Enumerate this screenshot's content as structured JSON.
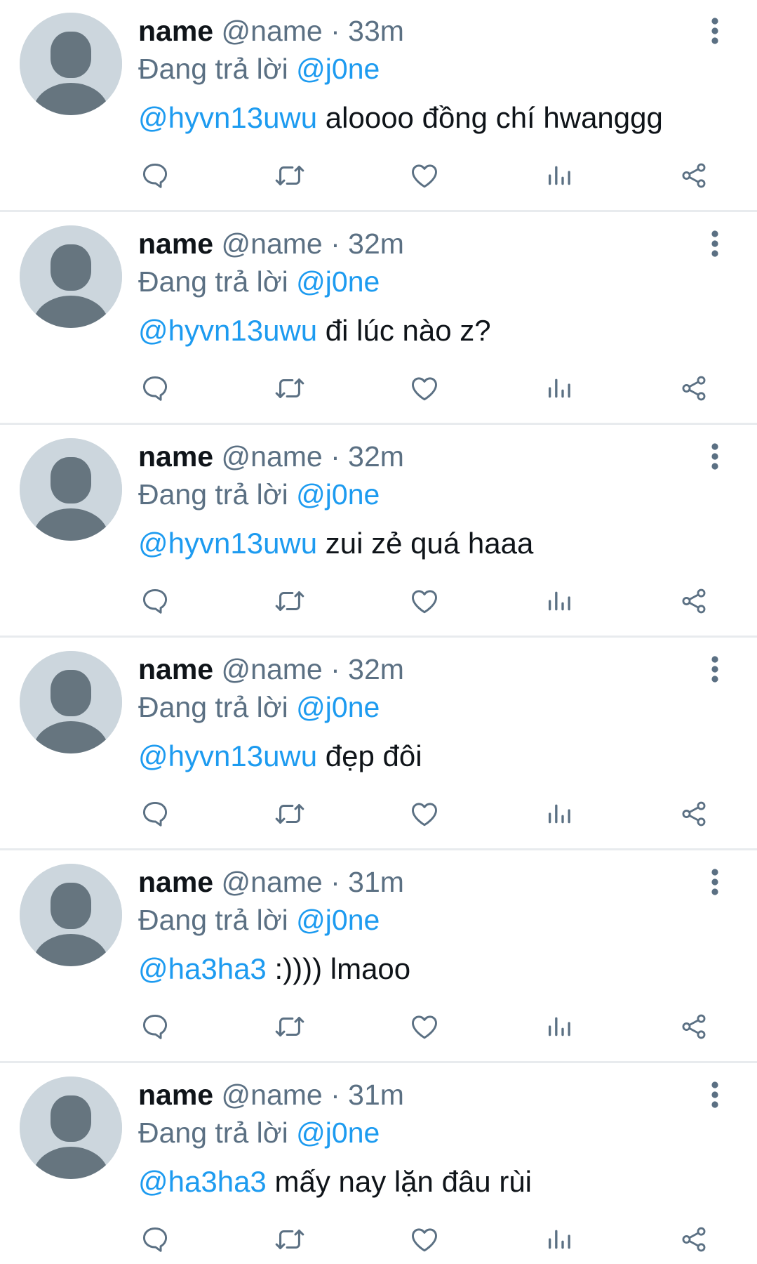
{
  "colors": {
    "primary_text": "#0f1419",
    "secondary_text": "#5b7083",
    "link": "#1d9bf0",
    "avatar_bg": "#ccd6dd",
    "avatar_fg": "#66757f",
    "divider": "#e8ebee"
  },
  "icons": {
    "reply": "reply-icon",
    "retweet": "retweet-icon",
    "like": "heart-icon",
    "views": "views-icon",
    "share": "share-icon",
    "more": "more-vertical-icon",
    "avatar": "default-avatar-icon"
  },
  "tweets": [
    {
      "name": "name",
      "handle": "@name",
      "separator": "·",
      "time": "33m",
      "reply_prefix": "Đang trả lời",
      "reply_to": "@j0ne",
      "mention": "@hyvn13uwu",
      "text": "aloooo đồng chí hwanggg"
    },
    {
      "name": "name",
      "handle": "@name",
      "separator": "·",
      "time": "32m",
      "reply_prefix": "Đang trả lời",
      "reply_to": "@j0ne",
      "mention": "@hyvn13uwu",
      "text": "đi lúc nào z?"
    },
    {
      "name": "name",
      "handle": "@name",
      "separator": "·",
      "time": "32m",
      "reply_prefix": "Đang trả lời",
      "reply_to": "@j0ne",
      "mention": "@hyvn13uwu",
      "text": "zui zẻ quá haaa"
    },
    {
      "name": "name",
      "handle": "@name",
      "separator": "·",
      "time": "32m",
      "reply_prefix": "Đang trả lời",
      "reply_to": "@j0ne",
      "mention": "@hyvn13uwu",
      "text": "đẹp đôi"
    },
    {
      "name": "name",
      "handle": "@name",
      "separator": "·",
      "time": "31m",
      "reply_prefix": "Đang trả lời",
      "reply_to": "@j0ne",
      "mention": "@ha3ha3",
      "text": ":)))) lmaoo"
    },
    {
      "name": "name",
      "handle": "@name",
      "separator": "·",
      "time": "31m",
      "reply_prefix": "Đang trả lời",
      "reply_to": "@j0ne",
      "mention": "@ha3ha3",
      "text": "mấy nay lặn đâu rùi"
    }
  ]
}
